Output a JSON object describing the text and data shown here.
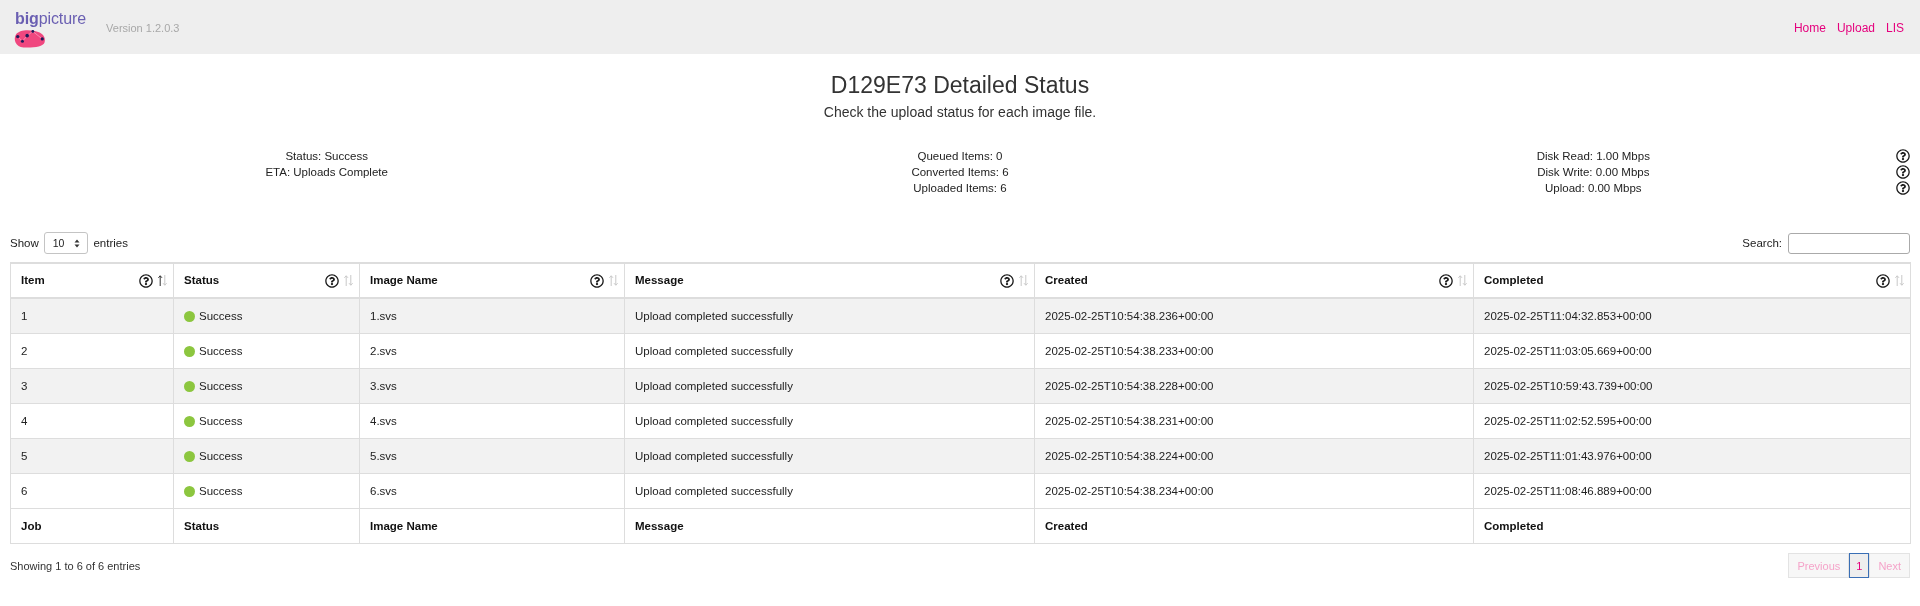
{
  "header": {
    "logo": "**big**picture",
    "version": "Version 1.2.0.3",
    "nav": [
      {
        "label": "Home"
      },
      {
        "label": "Upload"
      },
      {
        "label": "LIS"
      }
    ]
  },
  "title": "D129E73 Detailed Status",
  "subtitle": "Check the upload status for each image file.",
  "summary": [
    {
      "items": [
        {
          "text": "Status: Success",
          "help": false
        },
        {
          "text": "ETA: Uploads Complete",
          "help": false
        }
      ]
    },
    {
      "items": [
        {
          "text": "Queued Items: 0",
          "help": false
        },
        {
          "text": "Converted Items: 6",
          "help": false
        },
        {
          "text": "Uploaded Items: 6",
          "help": false
        }
      ]
    },
    {
      "items": [
        {
          "text": "Disk Read: 1.00 Mbps",
          "help": true
        },
        {
          "text": "Disk Write: 0.00 Mbps",
          "help": true
        },
        {
          "text": "Upload: 0.00 Mbps",
          "help": true
        }
      ]
    }
  ],
  "length_menu": {
    "before": "Show",
    "value": "10",
    "after": "entries"
  },
  "search": {
    "label": "Search:"
  },
  "table": {
    "columns": [
      {
        "label": "Item",
        "help": true,
        "sorted": true
      },
      {
        "label": "Status",
        "help": true,
        "sorted": false
      },
      {
        "label": "Image Name",
        "help": true,
        "sorted": false
      },
      {
        "label": "Message",
        "help": true,
        "sorted": false
      },
      {
        "label": "Created",
        "help": true,
        "sorted": false
      },
      {
        "label": "Completed",
        "help": true,
        "sorted": false
      }
    ],
    "rows": [
      {
        "item": "1",
        "status": {
          "label": "Success",
          "kind": "success"
        },
        "image": "1.svs",
        "message": "Upload completed successfully",
        "created": "2025-02-25T10:54:38.236+00:00",
        "completed": "2025-02-25T11:04:32.853+00:00"
      },
      {
        "item": "2",
        "status": {
          "label": "Success",
          "kind": "success"
        },
        "image": "2.svs",
        "message": "Upload completed successfully",
        "created": "2025-02-25T10:54:38.233+00:00",
        "completed": "2025-02-25T11:03:05.669+00:00"
      },
      {
        "item": "3",
        "status": {
          "label": "Success",
          "kind": "success"
        },
        "image": "3.svs",
        "message": "Upload completed successfully",
        "created": "2025-02-25T10:54:38.228+00:00",
        "completed": "2025-02-25T10:59:43.739+00:00"
      },
      {
        "item": "4",
        "status": {
          "label": "Success",
          "kind": "success"
        },
        "image": "4.svs",
        "message": "Upload completed successfully",
        "created": "2025-02-25T10:54:38.231+00:00",
        "completed": "2025-02-25T11:02:52.595+00:00"
      },
      {
        "item": "5",
        "status": {
          "label": "Success",
          "kind": "success"
        },
        "image": "5.svs",
        "message": "Upload completed successfully",
        "created": "2025-02-25T10:54:38.224+00:00",
        "completed": "2025-02-25T11:01:43.976+00:00"
      },
      {
        "item": "6",
        "status": {
          "label": "Success",
          "kind": "success"
        },
        "image": "6.svs",
        "message": "Upload completed successfully",
        "created": "2025-02-25T10:54:38.234+00:00",
        "completed": "2025-02-25T11:08:46.889+00:00"
      }
    ],
    "footer": [
      "Job",
      "Status",
      "Image Name",
      "Message",
      "Created",
      "Completed"
    ]
  },
  "info": "Showing 1 to 6 of 6 entries",
  "pagination": [
    {
      "label": "Previous",
      "kind": "nav",
      "disabled": true,
      "selected": false
    },
    {
      "label": "1",
      "kind": "page",
      "disabled": false,
      "selected": true
    },
    {
      "label": "Next",
      "kind": "nav",
      "disabled": true,
      "selected": false
    }
  ]
}
